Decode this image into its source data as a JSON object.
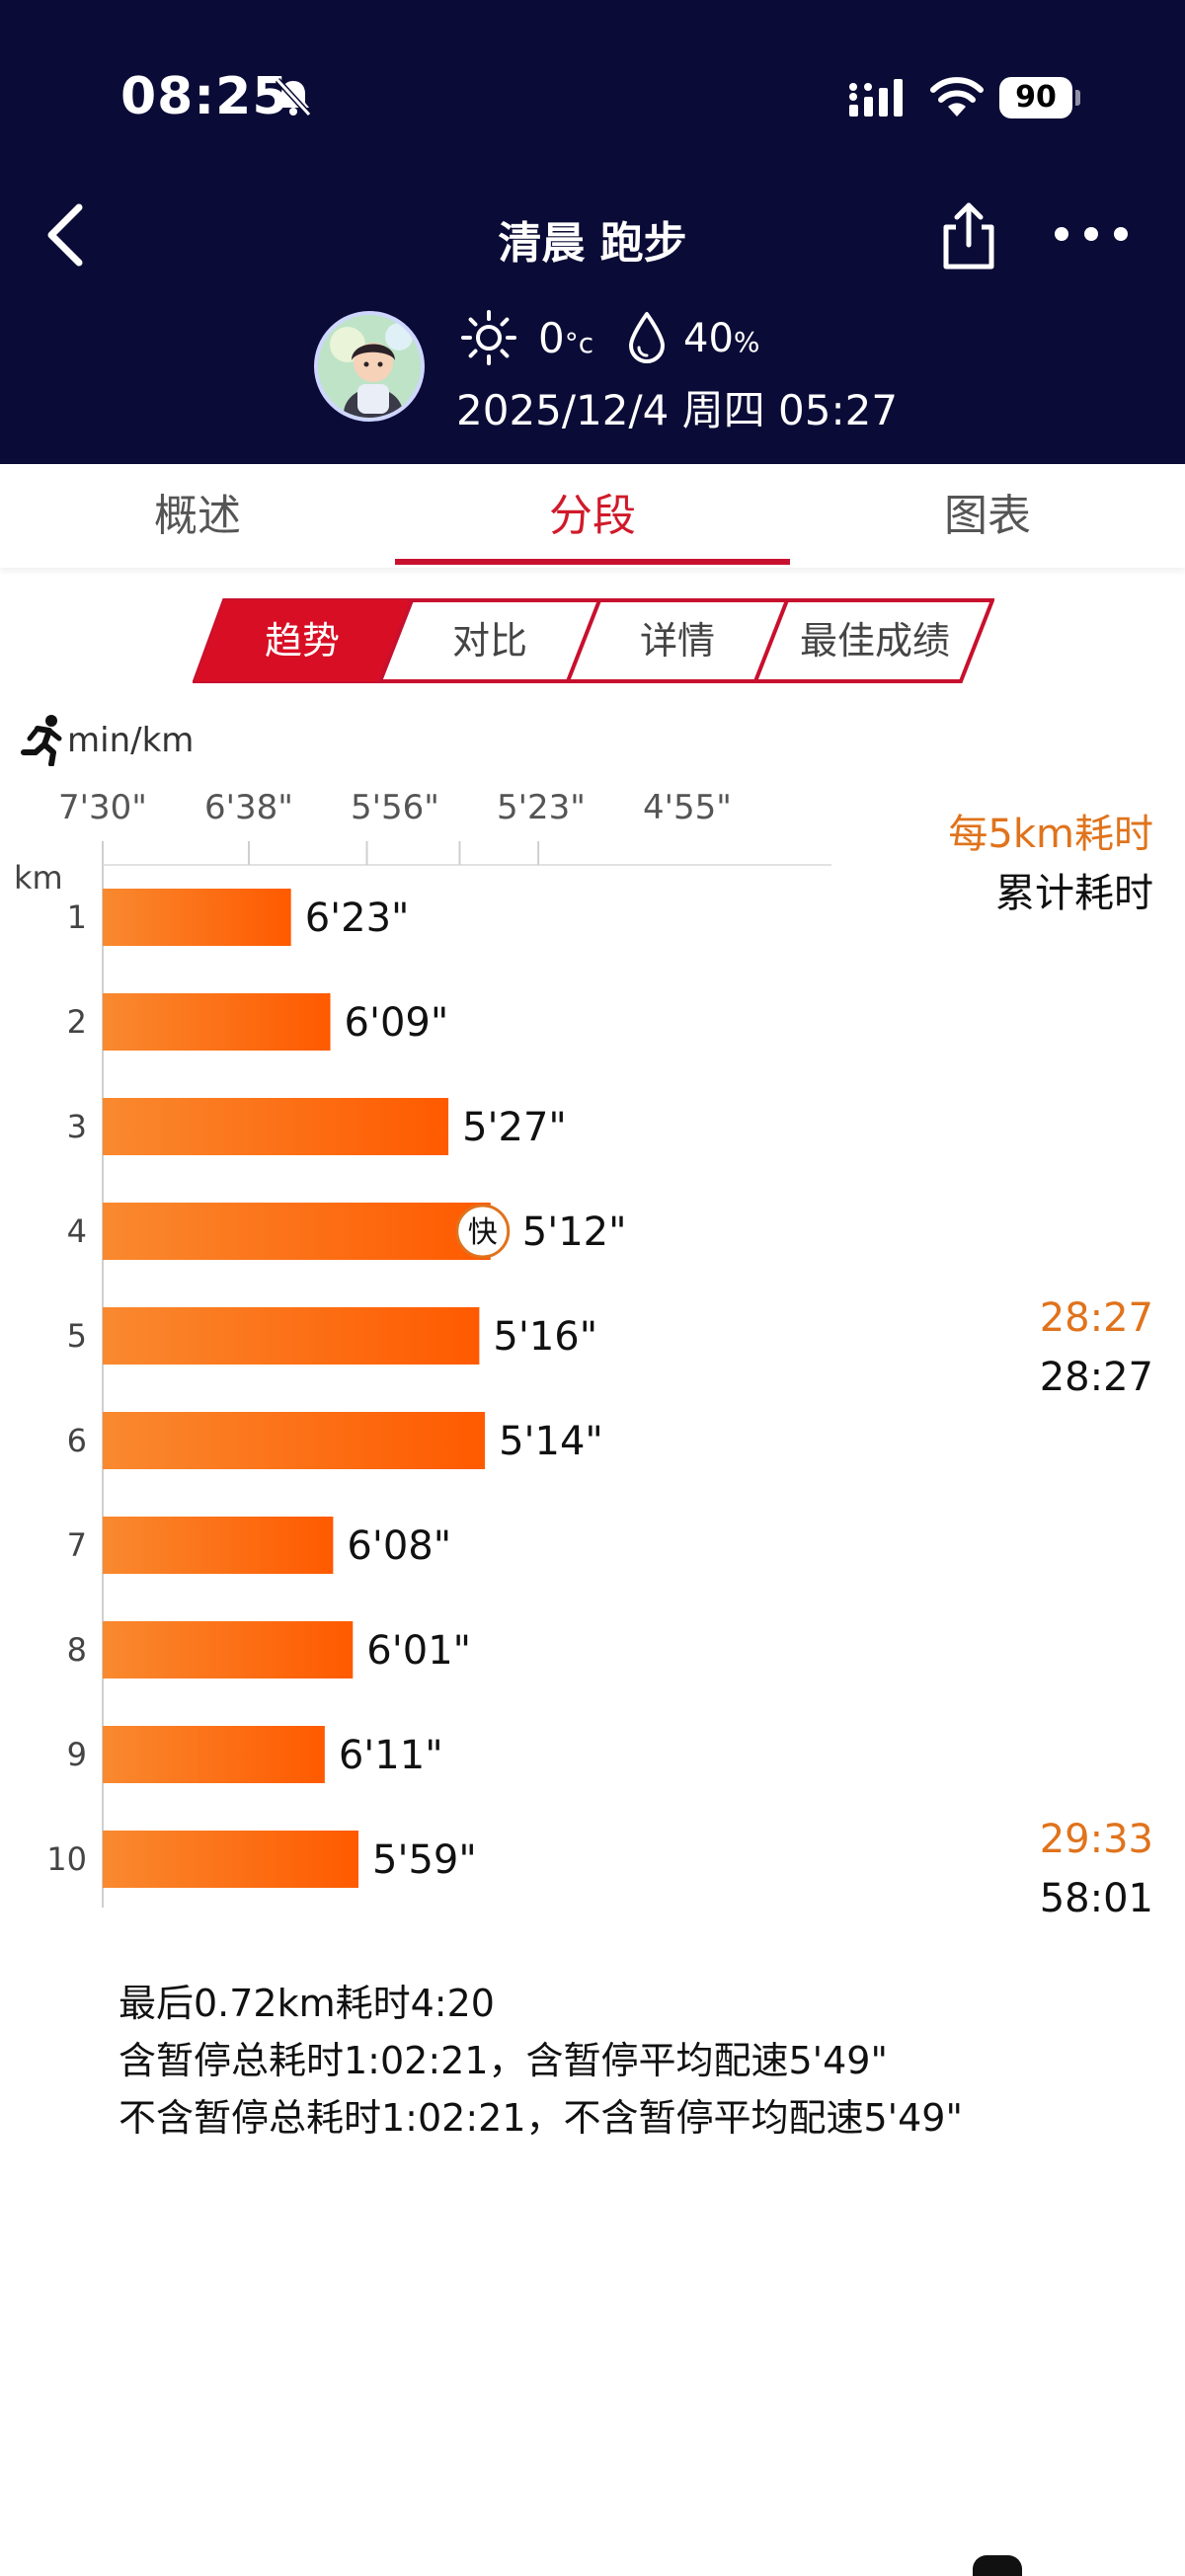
{
  "status_bar": {
    "time": "08:25",
    "battery": "90"
  },
  "nav": {
    "title": "清晨 跑步"
  },
  "info": {
    "temperature": "0",
    "temp_unit": "°c",
    "humidity": "40",
    "humidity_unit": "%",
    "datetime": "2025/12/4 周四 05:27"
  },
  "tabs": [
    {
      "label": "概述",
      "active": false
    },
    {
      "label": "分段",
      "active": true
    },
    {
      "label": "图表",
      "active": false
    }
  ],
  "segments": [
    {
      "label": "趋势",
      "active": true
    },
    {
      "label": "对比",
      "active": false
    },
    {
      "label": "详情",
      "active": false
    },
    {
      "label": "最佳成绩",
      "active": false
    }
  ],
  "chart_data": {
    "type": "bar",
    "orientation": "horizontal",
    "unit_label": "min/km",
    "ylabel": "km",
    "x_ticks": [
      "7'30\"",
      "6'38\"",
      "5'56\"",
      "5'23\"",
      "4'55\""
    ],
    "x_tick_seconds": [
      450,
      398,
      356,
      323,
      295
    ],
    "categories": [
      "1",
      "2",
      "3",
      "4",
      "5",
      "6",
      "7",
      "8",
      "9",
      "10"
    ],
    "values": [
      "6'23\"",
      "6'09\"",
      "5'27\"",
      "5'12\"",
      "5'16\"",
      "5'14\"",
      "6'08\"",
      "6'01\"",
      "6'11\"",
      "5'59\""
    ],
    "values_seconds": [
      383,
      369,
      327,
      312,
      316,
      314,
      368,
      361,
      371,
      359
    ],
    "fastest_badge": {
      "km": "4",
      "label": "快"
    },
    "legend": [
      "每5km耗时",
      "累计耗时"
    ],
    "colors": {
      "bar_start": "#f9892f",
      "bar_end": "#ff5a00",
      "accent": "#e0731c"
    },
    "cumulative": [
      {
        "km": "5",
        "split": "28:27",
        "total": "28:27"
      },
      {
        "km": "10",
        "split": "29:33",
        "total": "58:01"
      }
    ]
  },
  "summary": [
    "最后0.72km耗时4:20",
    "含暂停总耗时1:02:21，含暂停平均配速5'49\"",
    "不含暂停总耗时1:02:21，不含暂停平均配速5'49\""
  ]
}
